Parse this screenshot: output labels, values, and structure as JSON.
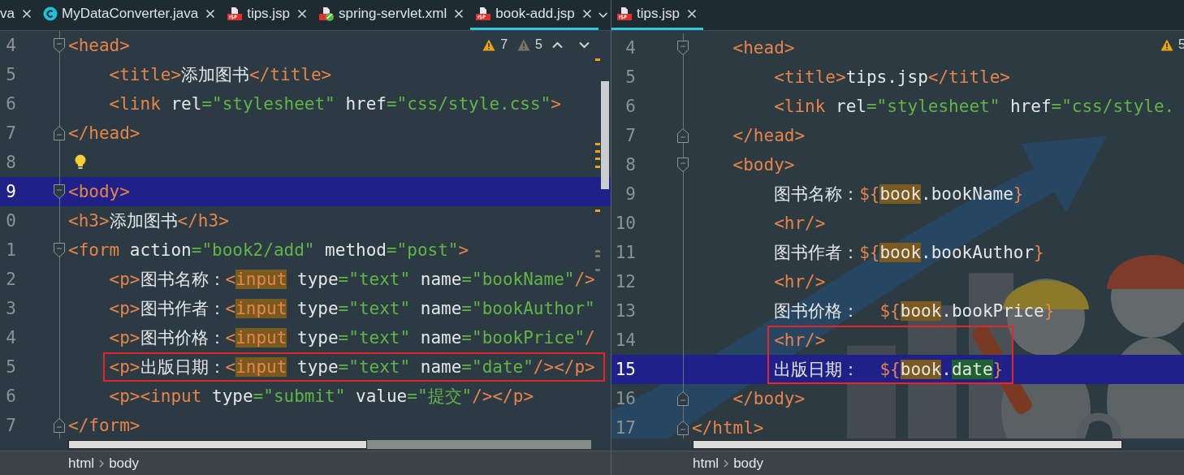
{
  "left": {
    "tabs": [
      {
        "label": "va",
        "selected": false
      },
      {
        "label": "MyDataConverter.java",
        "kind": "class",
        "selected": false
      },
      {
        "label": "tips.jsp",
        "kind": "jsp",
        "selected": false
      },
      {
        "label": "spring-servlet.xml",
        "kind": "xml",
        "selected": false
      },
      {
        "label": "book-add.jsp",
        "kind": "jsp",
        "selected": true
      }
    ],
    "inspections": [
      {
        "kind": "warning",
        "count": "7"
      },
      {
        "kind": "weak_warning",
        "count": "5"
      }
    ],
    "lines": [
      {
        "number": "4",
        "fold_start": true,
        "current": false,
        "boxed": false,
        "tokens": [
          {
            "kind": "tag",
            "t": "<head>"
          }
        ]
      },
      {
        "number": "5",
        "current": false,
        "boxed": false,
        "tokens": [
          {
            "kind": "tag",
            "t": "    <title>"
          },
          {
            "kind": "text",
            "t": "添加图书"
          },
          {
            "kind": "tag",
            "t": "</title>"
          }
        ]
      },
      {
        "number": "6",
        "current": false,
        "boxed": false,
        "tokens": [
          {
            "kind": "tag",
            "t": "    <link"
          },
          {
            "kind": "attr",
            "t": " rel"
          },
          {
            "kind": "value",
            "t": "=\"stylesheet\""
          },
          {
            "kind": "attr",
            "t": " href"
          },
          {
            "kind": "value",
            "t": "=\"css/style.css\""
          },
          {
            "kind": "tag",
            "t": ">"
          }
        ]
      },
      {
        "number": "7",
        "fold_end": true,
        "current": false,
        "boxed": false,
        "tokens": [
          {
            "kind": "tag",
            "t": "</head>"
          }
        ]
      },
      {
        "number": "8",
        "bulb": true,
        "current": false,
        "boxed": false
      },
      {
        "number": "9",
        "fold_start": true,
        "current": true,
        "boxed": false,
        "tokens": [
          {
            "kind": "tag",
            "t": "<body>"
          }
        ]
      },
      {
        "number": "0",
        "current": false,
        "boxed": false,
        "tokens": [
          {
            "kind": "tag",
            "t": "<h3>"
          },
          {
            "kind": "text",
            "t": "添加图书"
          },
          {
            "kind": "tag",
            "t": "</h3>"
          }
        ]
      },
      {
        "number": "1",
        "fold_start": true,
        "current": false,
        "boxed": false,
        "tokens": [
          {
            "kind": "tag",
            "t": "<form"
          },
          {
            "kind": "attr",
            "t": " action"
          },
          {
            "kind": "value",
            "t": "=\"book2/add\""
          },
          {
            "kind": "attr",
            "t": " method"
          },
          {
            "kind": "value",
            "t": "=\"post\""
          },
          {
            "kind": "tag",
            "t": ">"
          }
        ]
      },
      {
        "number": "2",
        "current": false,
        "boxed": false,
        "tokens": [
          {
            "kind": "tag",
            "t": "    <p>"
          },
          {
            "kind": "text",
            "t": "图书名称："
          },
          {
            "kind": "tag",
            "t": "<"
          },
          {
            "kind": "tag_usage",
            "t": "input"
          },
          {
            "kind": "attr",
            "t": " type"
          },
          {
            "kind": "value",
            "t": "=\"text\""
          },
          {
            "kind": "attr",
            "t": " name"
          },
          {
            "kind": "value",
            "t": "=\"bookName\""
          },
          {
            "kind": "tag",
            "t": "/>"
          }
        ]
      },
      {
        "number": "3",
        "current": false,
        "boxed": false,
        "tokens": [
          {
            "kind": "tag",
            "t": "    <p>"
          },
          {
            "kind": "text",
            "t": "图书作者："
          },
          {
            "kind": "tag",
            "t": "<"
          },
          {
            "kind": "tag_usage",
            "t": "input"
          },
          {
            "kind": "attr",
            "t": " type"
          },
          {
            "kind": "value",
            "t": "=\"text\""
          },
          {
            "kind": "attr",
            "t": " name"
          },
          {
            "kind": "value",
            "t": "=\"bookAuthor\""
          }
        ]
      },
      {
        "number": "4",
        "current": false,
        "boxed": false,
        "tokens": [
          {
            "kind": "tag",
            "t": "    <p>"
          },
          {
            "kind": "text",
            "t": "图书价格："
          },
          {
            "kind": "tag",
            "t": "<"
          },
          {
            "kind": "tag_usage",
            "t": "input"
          },
          {
            "kind": "attr",
            "t": " type"
          },
          {
            "kind": "value",
            "t": "=\"text\""
          },
          {
            "kind": "attr",
            "t": " name"
          },
          {
            "kind": "value",
            "t": "=\"bookPrice\""
          },
          {
            "kind": "tag",
            "t": "/"
          }
        ]
      },
      {
        "number": "5",
        "current": false,
        "boxed": true,
        "tokens": [
          {
            "kind": "tag",
            "t": "    <p>"
          },
          {
            "kind": "text",
            "t": "出版日期："
          },
          {
            "kind": "tag",
            "t": "<"
          },
          {
            "kind": "tag_usage",
            "t": "input"
          },
          {
            "kind": "attr",
            "t": " type"
          },
          {
            "kind": "value",
            "t": "=\"text\""
          },
          {
            "kind": "attr",
            "t": " name"
          },
          {
            "kind": "value",
            "t": "=\"date\""
          },
          {
            "kind": "tag",
            "t": "/></p>"
          }
        ]
      },
      {
        "number": "6",
        "current": false,
        "boxed": false,
        "tokens": [
          {
            "kind": "tag",
            "t": "    <p><input"
          },
          {
            "kind": "attr",
            "t": " type"
          },
          {
            "kind": "value",
            "t": "=\"submit\""
          },
          {
            "kind": "attr",
            "t": " value"
          },
          {
            "kind": "value",
            "t": "=\"提交\""
          },
          {
            "kind": "tag",
            "t": "/></p>"
          }
        ]
      },
      {
        "number": "7",
        "fold_end": true,
        "current": false,
        "boxed": false,
        "tokens": [
          {
            "kind": "tag",
            "t": "</form>"
          }
        ]
      }
    ],
    "breadcrumbs": [
      "html",
      "body"
    ]
  },
  "right": {
    "tabs": [
      {
        "label": "tips.jsp",
        "kind": "jsp",
        "selected": true
      }
    ],
    "inspections": [
      {
        "kind": "warning",
        "count": "5"
      }
    ],
    "background": {
      "kind": "picture"
    },
    "lines": [
      {
        "number": "4",
        "fold_start": true,
        "current": false,
        "boxed": false,
        "tokens": [
          {
            "kind": "tag",
            "t": "    <head>"
          }
        ]
      },
      {
        "number": "5",
        "current": false,
        "boxed": false,
        "tokens": [
          {
            "kind": "tag",
            "t": "        <title>"
          },
          {
            "kind": "text",
            "t": "tips.jsp"
          },
          {
            "kind": "tag",
            "t": "</title>"
          }
        ]
      },
      {
        "number": "6",
        "current": false,
        "boxed": false,
        "tokens": [
          {
            "kind": "tag",
            "t": "        <link"
          },
          {
            "kind": "attr",
            "t": " rel"
          },
          {
            "kind": "value",
            "t": "=\"stylesheet\""
          },
          {
            "kind": "attr",
            "t": " href"
          },
          {
            "kind": "value",
            "t": "=\"css/style."
          }
        ]
      },
      {
        "number": "7",
        "fold_end": true,
        "current": false,
        "boxed": false,
        "tokens": [
          {
            "kind": "tag",
            "t": "    </head>"
          }
        ]
      },
      {
        "number": "8",
        "fold_start": true,
        "current": false,
        "boxed": false,
        "tokens": [
          {
            "kind": "tag",
            "t": "    <body>"
          }
        ]
      },
      {
        "number": "9",
        "current": false,
        "boxed": false,
        "tokens": [
          {
            "kind": "text",
            "t": "        图书名称："
          },
          {
            "kind": "tag",
            "t": "${"
          },
          {
            "kind": "text_usage",
            "t": "book"
          },
          {
            "kind": "text",
            "t": ".bookName"
          },
          {
            "kind": "tag",
            "t": "}"
          }
        ]
      },
      {
        "number": "10",
        "current": false,
        "boxed": false,
        "tokens": [
          {
            "kind": "tag",
            "t": "        <hr/>"
          }
        ]
      },
      {
        "number": "11",
        "current": false,
        "boxed": false,
        "tokens": [
          {
            "kind": "text",
            "t": "        图书作者："
          },
          {
            "kind": "tag",
            "t": "${"
          },
          {
            "kind": "text_usage",
            "t": "book"
          },
          {
            "kind": "text",
            "t": ".bookAuthor"
          },
          {
            "kind": "tag",
            "t": "}"
          }
        ]
      },
      {
        "number": "12",
        "current": false,
        "boxed": false,
        "tokens": [
          {
            "kind": "tag",
            "t": "        <hr/>"
          }
        ]
      },
      {
        "number": "13",
        "current": false,
        "boxed": false,
        "tokens": [
          {
            "kind": "text",
            "t": "        图书价格：  "
          },
          {
            "kind": "tag",
            "t": "${"
          },
          {
            "kind": "text_usage",
            "t": "book"
          },
          {
            "kind": "text",
            "t": ".bookPrice"
          },
          {
            "kind": "tag",
            "t": "}"
          }
        ]
      },
      {
        "number": "14",
        "current": false,
        "boxed": true,
        "tokens": [
          {
            "kind": "tag",
            "t": "        <hr/>"
          }
        ]
      },
      {
        "number": "15",
        "current": true,
        "boxed": true,
        "tokens": [
          {
            "kind": "text",
            "t": "        出版日期：  "
          },
          {
            "kind": "tag",
            "t": "${"
          },
          {
            "kind": "text_usage",
            "t": "book"
          },
          {
            "kind": "text",
            "t": "."
          },
          {
            "kind": "text_write",
            "t": "date"
          },
          {
            "kind": "tag",
            "t": "}"
          }
        ]
      },
      {
        "number": "16",
        "fold_end": true,
        "current": false,
        "boxed": false,
        "tokens": [
          {
            "kind": "tag",
            "t": "    </body>"
          }
        ]
      },
      {
        "number": "17",
        "fold_end": true,
        "current": false,
        "boxed": false,
        "tokens": [
          {
            "kind": "tag",
            "t": "</html>"
          }
        ]
      }
    ],
    "breadcrumbs": [
      "html",
      "body"
    ]
  }
}
